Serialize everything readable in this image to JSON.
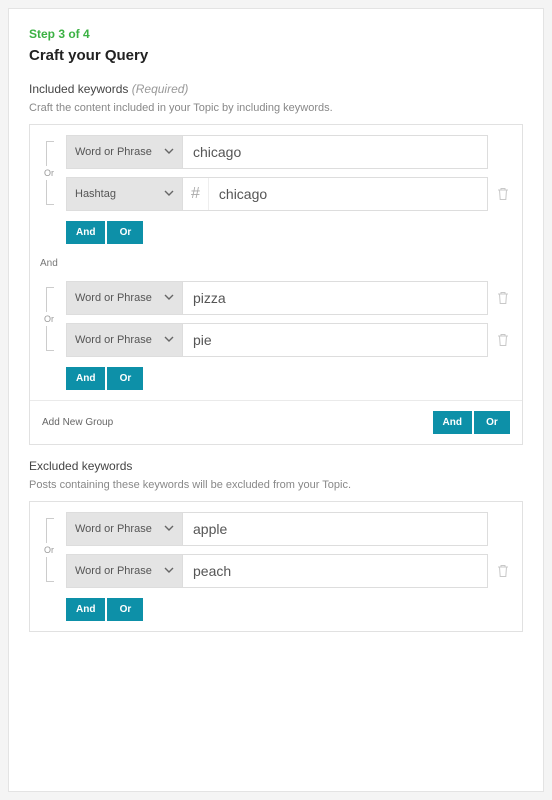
{
  "step": "Step 3 of 4",
  "title": "Craft your Query",
  "included": {
    "heading": "Included keywords",
    "required": "(Required)",
    "desc": "Craft the content included in your Topic by including keywords.",
    "groups": [
      {
        "rows": [
          {
            "type": "Word or Phrase",
            "prefix": "",
            "value": "chicago",
            "deletable": false
          },
          {
            "type": "Hashtag",
            "prefix": "#",
            "value": "chicago",
            "deletable": true
          }
        ]
      },
      {
        "rows": [
          {
            "type": "Word or Phrase",
            "prefix": "",
            "value": "pizza",
            "deletable": true
          },
          {
            "type": "Word or Phrase",
            "prefix": "",
            "value": "pie",
            "deletable": true
          }
        ]
      }
    ],
    "add_group": "Add New Group"
  },
  "excluded": {
    "heading": "Excluded keywords",
    "desc": "Posts containing these keywords will be excluded from your Topic.",
    "groups": [
      {
        "rows": [
          {
            "type": "Word or Phrase",
            "prefix": "",
            "value": "apple",
            "deletable": false
          },
          {
            "type": "Word or Phrase",
            "prefix": "",
            "value": "peach",
            "deletable": true
          }
        ]
      }
    ]
  },
  "labels": {
    "or": "Or",
    "and": "And",
    "and_join": "And"
  }
}
